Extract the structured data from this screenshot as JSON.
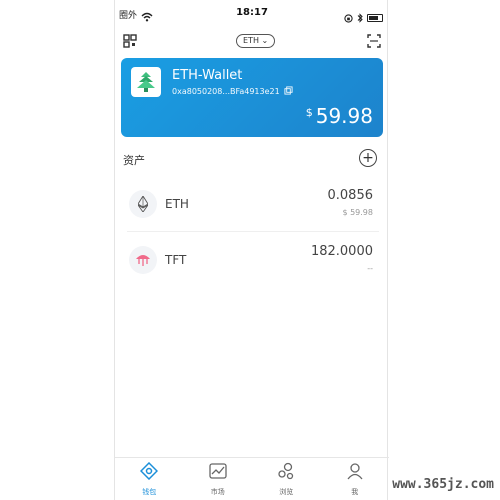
{
  "status_bar": {
    "carrier": "圈外",
    "time": "18:17"
  },
  "topbar": {
    "network": "ETH",
    "qr_icon": "qr-code-icon",
    "scan_icon": "scan-icon"
  },
  "wallet": {
    "name": "ETH-Wallet",
    "address": "0xa8050208...BFa4913e21",
    "currency_symbol": "$",
    "balance": "59.98",
    "accent": "#1b8fd8"
  },
  "assets": {
    "title": "资产",
    "add_label": "+",
    "tokens": [
      {
        "symbol": "ETH",
        "amount": "0.0856",
        "fiat": "$ 59.98",
        "icon": "ethereum-icon"
      },
      {
        "symbol": "TFT",
        "amount": "182.0000",
        "fiat": "--",
        "icon": "tft-icon"
      }
    ]
  },
  "tabs": [
    {
      "label": "钱包",
      "icon": "wallet-icon",
      "active": true
    },
    {
      "label": "市场",
      "icon": "market-icon",
      "active": false
    },
    {
      "label": "浏览",
      "icon": "browse-icon",
      "active": false
    },
    {
      "label": "我",
      "icon": "profile-icon",
      "active": false
    }
  ],
  "watermark": "www.365jz.com"
}
